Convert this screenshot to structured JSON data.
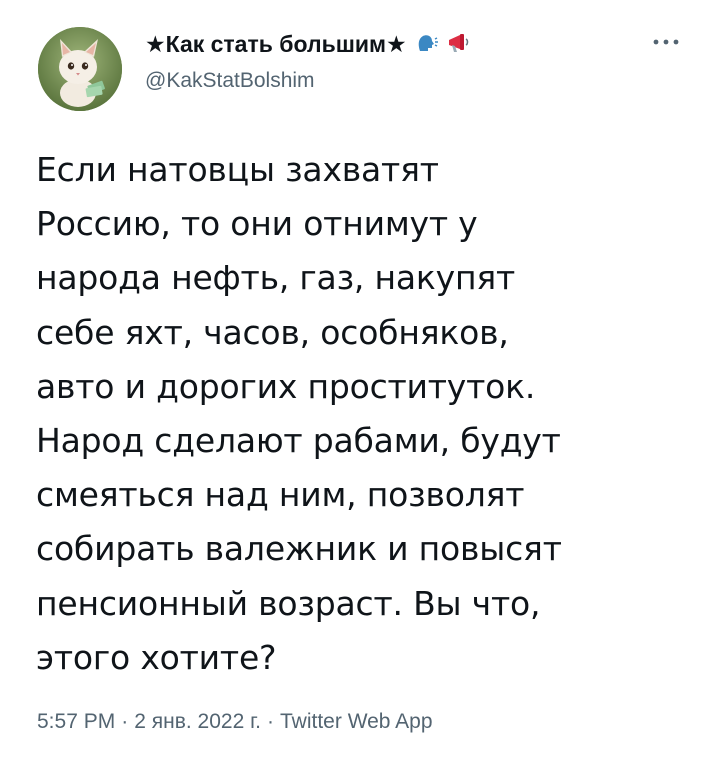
{
  "author": {
    "display_name": "★Как стать большим★",
    "handle": "@KakStatBolshim",
    "emoji_icons": [
      "speaking-head-icon",
      "megaphone-icon"
    ]
  },
  "tweet": {
    "lines": [
      "Если натовцы захватят",
      "Россию, то они отнимут у",
      "народа нефть, газ, накупят",
      "себе яхт, часов, особняков,",
      "авто и дорогих проституток.",
      "Народ сделают рабами, будут",
      "смеяться над ним, позволят",
      "собирать валежник и повысят",
      "пенсионный возраст. Вы что,",
      "этого хотите?"
    ]
  },
  "meta": {
    "time": "5:57 PM",
    "separator": "·",
    "date": "2 янв. 2022 г.",
    "source": "Twitter Web App"
  },
  "colors": {
    "text": "#0f1419",
    "secondary": "#536471"
  }
}
